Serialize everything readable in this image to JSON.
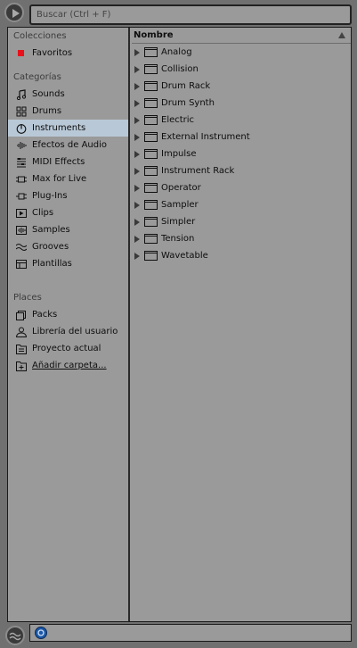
{
  "search": {
    "placeholder": "Buscar (Ctrl + F)"
  },
  "sidebar": {
    "collections_header": "Colecciones",
    "collections": [
      {
        "label": "Favoritos",
        "color": "#e8101a"
      }
    ],
    "categories_header": "Categorías",
    "categories": [
      {
        "label": "Sounds",
        "icon": "music-note-icon"
      },
      {
        "label": "Drums",
        "icon": "drum-grid-icon"
      },
      {
        "label": "Instruments",
        "icon": "power-icon",
        "selected": true
      },
      {
        "label": "Efectos de Audio",
        "icon": "audio-effects-icon"
      },
      {
        "label": "MIDI Effects",
        "icon": "midi-effects-icon"
      },
      {
        "label": "Max for Live",
        "icon": "max-for-live-icon"
      },
      {
        "label": "Plug-Ins",
        "icon": "plugin-icon"
      },
      {
        "label": "Clips",
        "icon": "clip-icon"
      },
      {
        "label": "Samples",
        "icon": "waveform-icon"
      },
      {
        "label": "Grooves",
        "icon": "groove-icon"
      },
      {
        "label": "Plantillas",
        "icon": "template-icon"
      }
    ],
    "places_header": "Places",
    "places": [
      {
        "label": "Packs",
        "icon": "packs-icon"
      },
      {
        "label": "Librería del usuario",
        "icon": "user-icon"
      },
      {
        "label": "Proyecto actual",
        "icon": "project-folder-icon"
      },
      {
        "label": "Añadir carpeta...",
        "icon": "add-folder-icon"
      }
    ]
  },
  "content": {
    "column_header": "Nombre",
    "items": [
      "Analog",
      "Collision",
      "Drum Rack",
      "Drum Synth",
      "Electric",
      "External Instrument",
      "Impulse",
      "Instrument Rack",
      "Operator",
      "Sampler",
      "Simpler",
      "Tension",
      "Wavetable"
    ]
  },
  "colors": {
    "panel": "#9a9a9a",
    "background": "#707070",
    "selection": "#b8c8d6",
    "favorite": "#e8101a",
    "hotswap": "#1c58a8"
  }
}
